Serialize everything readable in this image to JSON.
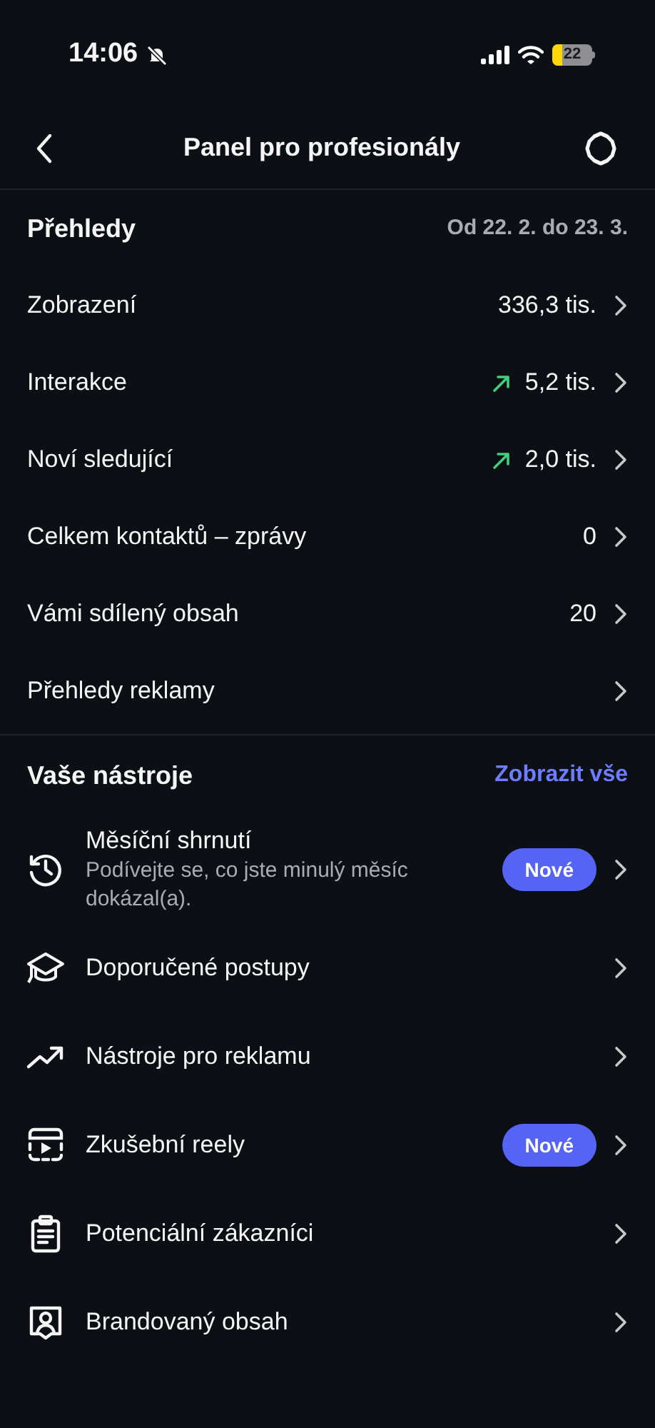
{
  "status_bar": {
    "time": "14:06",
    "battery": "22"
  },
  "nav": {
    "title": "Panel pro profesionály"
  },
  "overview": {
    "title": "Přehledy",
    "range": "Od 22. 2. do 23. 3.",
    "rows": [
      {
        "label": "Zobrazení",
        "value": "336,3 tis.",
        "rising": false
      },
      {
        "label": "Interakce",
        "value": "5,2 tis.",
        "rising": true
      },
      {
        "label": "Noví sledující",
        "value": "2,0 tis.",
        "rising": true
      },
      {
        "label": "Celkem kontaktů – zprávy",
        "value": "0",
        "rising": false
      },
      {
        "label": "Vámi sdílený obsah",
        "value": "20",
        "rising": false
      },
      {
        "label": "Přehledy reklamy",
        "rising": false
      }
    ]
  },
  "tools": {
    "title": "Vaše nástroje",
    "link": "Zobrazit vše",
    "items": [
      {
        "kind": "history",
        "label": "Měsíční shrnutí",
        "subtitle": "Podívejte se, co jste minulý měsíc dokázal(a).",
        "badge": "Nové"
      },
      {
        "kind": "graduation",
        "label": "Doporučené postupy"
      },
      {
        "kind": "trend",
        "label": "Nástroje pro reklamu"
      },
      {
        "kind": "reel",
        "label": "Zkušební reely",
        "badge": "Nové"
      },
      {
        "kind": "clipboard",
        "label": "Potenciální zákazníci"
      },
      {
        "kind": "person",
        "label": "Brandovaný obsah"
      }
    ]
  }
}
